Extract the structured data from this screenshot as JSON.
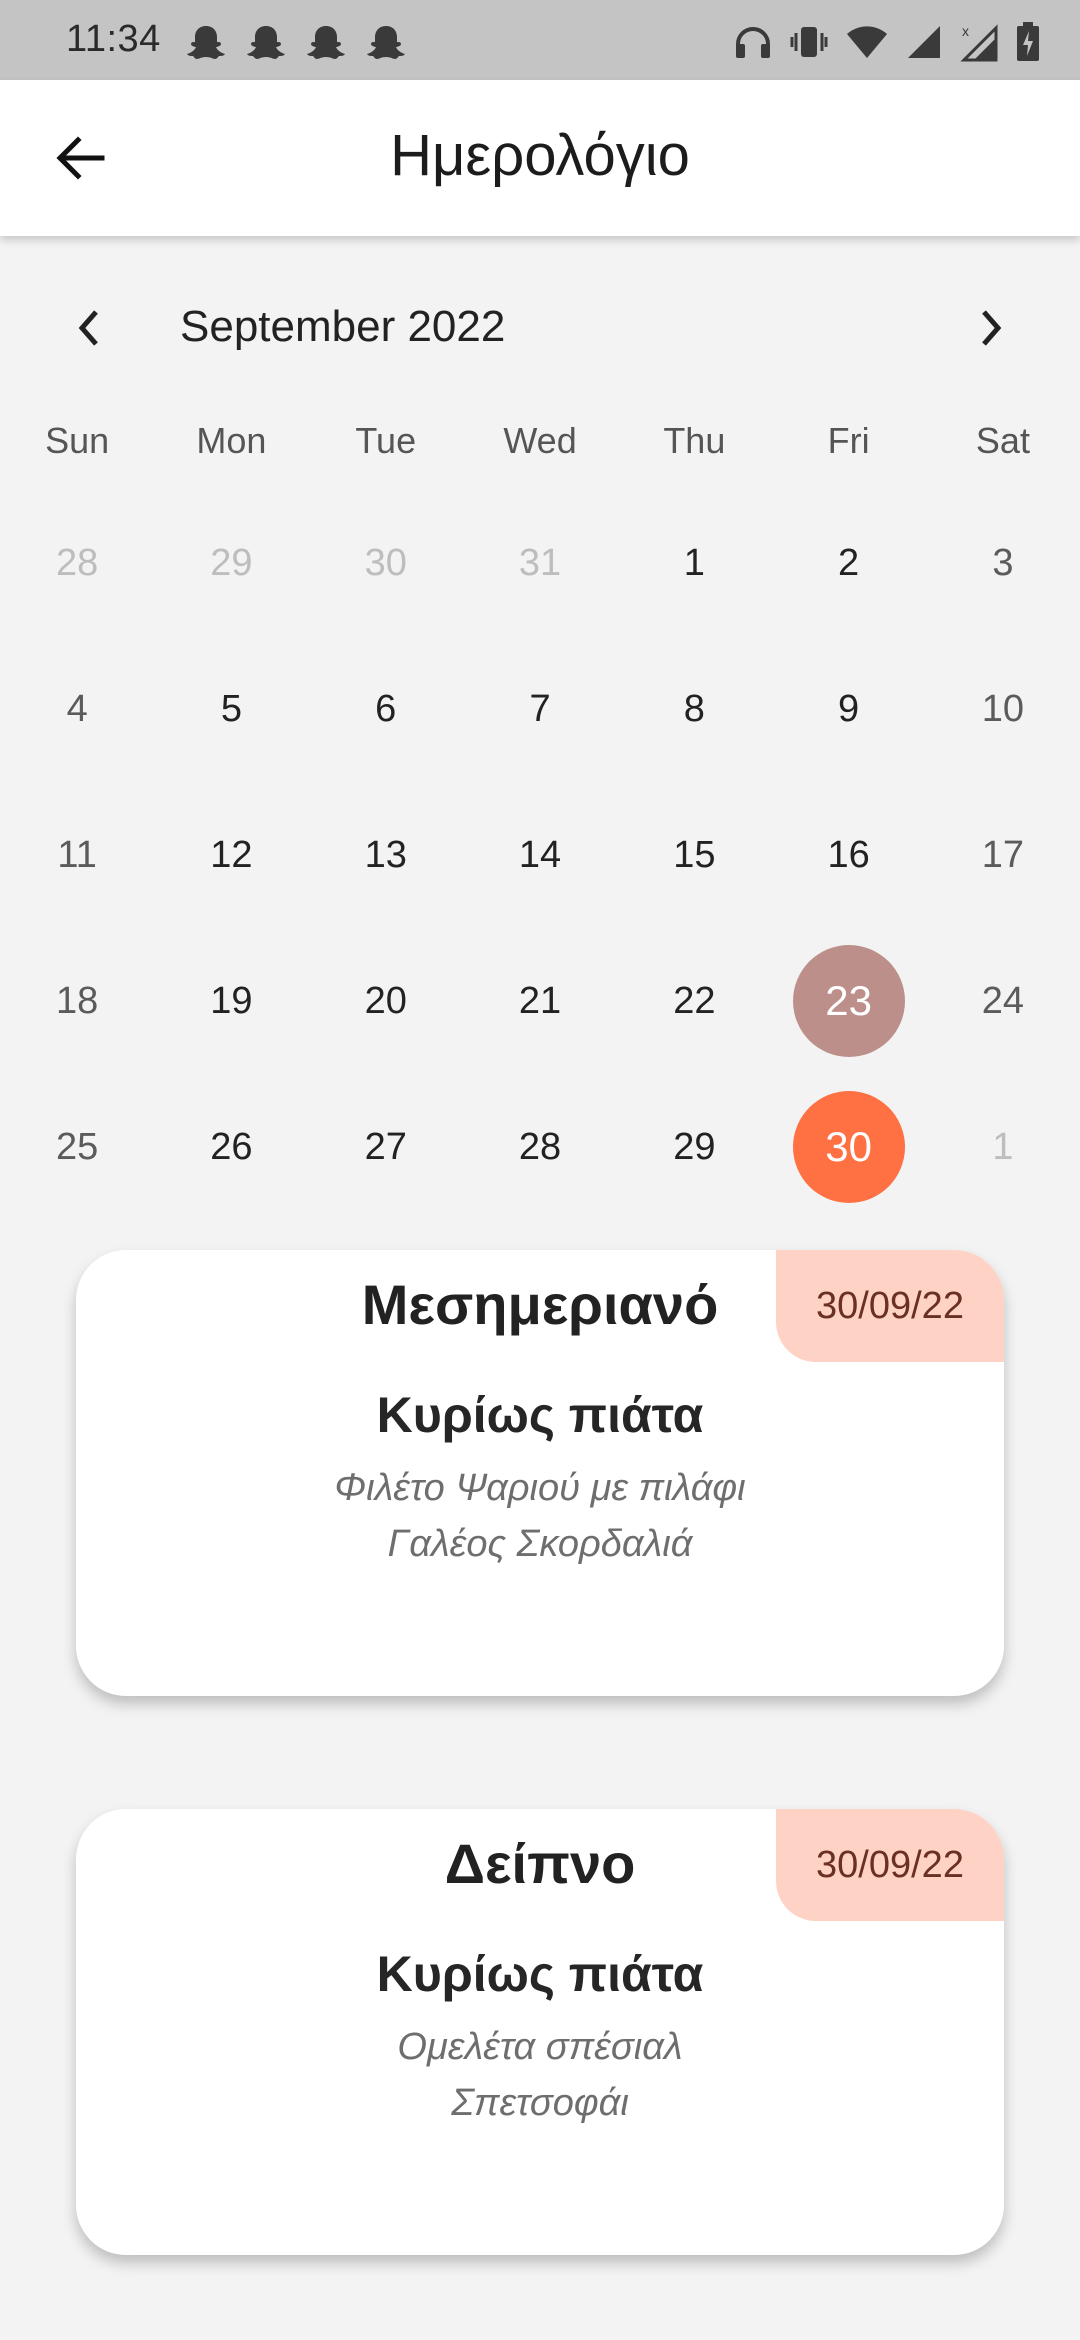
{
  "status_bar": {
    "time": "11:34",
    "notification_icons": [
      "snapchat-icon",
      "snapchat-icon",
      "snapchat-icon",
      "snapchat-icon"
    ],
    "system_icons": [
      "headphones-icon",
      "vibrate-icon",
      "wifi-icon",
      "signal-icon",
      "signal-no-data-icon",
      "battery-charging-icon"
    ]
  },
  "app_bar": {
    "title": "Ημερολόγιο",
    "back_icon": "arrow-back-icon"
  },
  "calendar": {
    "month_label": "September 2022",
    "weekdays": [
      "Sun",
      "Mon",
      "Tue",
      "Wed",
      "Thu",
      "Fri",
      "Sat"
    ],
    "weeks": [
      [
        "28",
        "29",
        "30",
        "31",
        "1",
        "2",
        "3"
      ],
      [
        "4",
        "5",
        "6",
        "7",
        "8",
        "9",
        "10"
      ],
      [
        "11",
        "12",
        "13",
        "14",
        "15",
        "16",
        "17"
      ],
      [
        "18",
        "19",
        "20",
        "21",
        "22",
        "23",
        "24"
      ],
      [
        "25",
        "26",
        "27",
        "28",
        "29",
        "30",
        "1"
      ]
    ],
    "today": "23",
    "selected": "30",
    "colors": {
      "today": "#bc8f8a",
      "selected": "#ff7043"
    }
  },
  "cards": [
    {
      "meal": "Μεσημεριανό",
      "date": "30/09/22",
      "section": "Κυρίως πιάτα",
      "items": [
        "Φιλέτο Ψαριού με πιλάφι",
        "Γαλέος Σκορδαλιά"
      ]
    },
    {
      "meal": "Δείπνο",
      "date": "30/09/22",
      "section": "Κυρίως πιάτα",
      "items": [
        "Ομελέτα σπέσιαλ",
        "Σπετσοφάι"
      ]
    }
  ],
  "accent_colors": {
    "date_badge_bg": "#ffd2c6",
    "date_badge_text": "#6a2f25"
  }
}
